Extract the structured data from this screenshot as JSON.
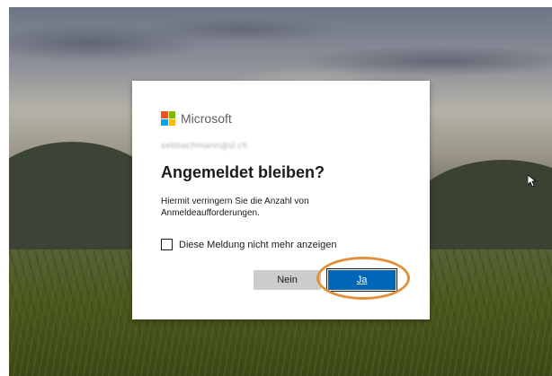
{
  "app": {
    "brand": "Microsoft",
    "account_email": "sebbachmann@sl.ch"
  },
  "dialog": {
    "title": "Angemeldet bleiben?",
    "description": "Hiermit verringern Sie die Anzahl von Anmeldeaufforderungen.",
    "checkbox_label": "Diese Meldung nicht mehr anzeigen",
    "checkbox_checked": false,
    "no_label": "Nein",
    "yes_label": "Ja"
  },
  "colors": {
    "primary_button": "#0067b8",
    "secondary_button": "#cccccc",
    "highlight_ring": "#e0913a",
    "ms_red": "#f25022",
    "ms_green": "#7fba00",
    "ms_blue": "#00a4ef",
    "ms_yellow": "#ffb900"
  },
  "icons": {
    "logo": "microsoft-logo",
    "cursor": "mouse-pointer-icon"
  }
}
